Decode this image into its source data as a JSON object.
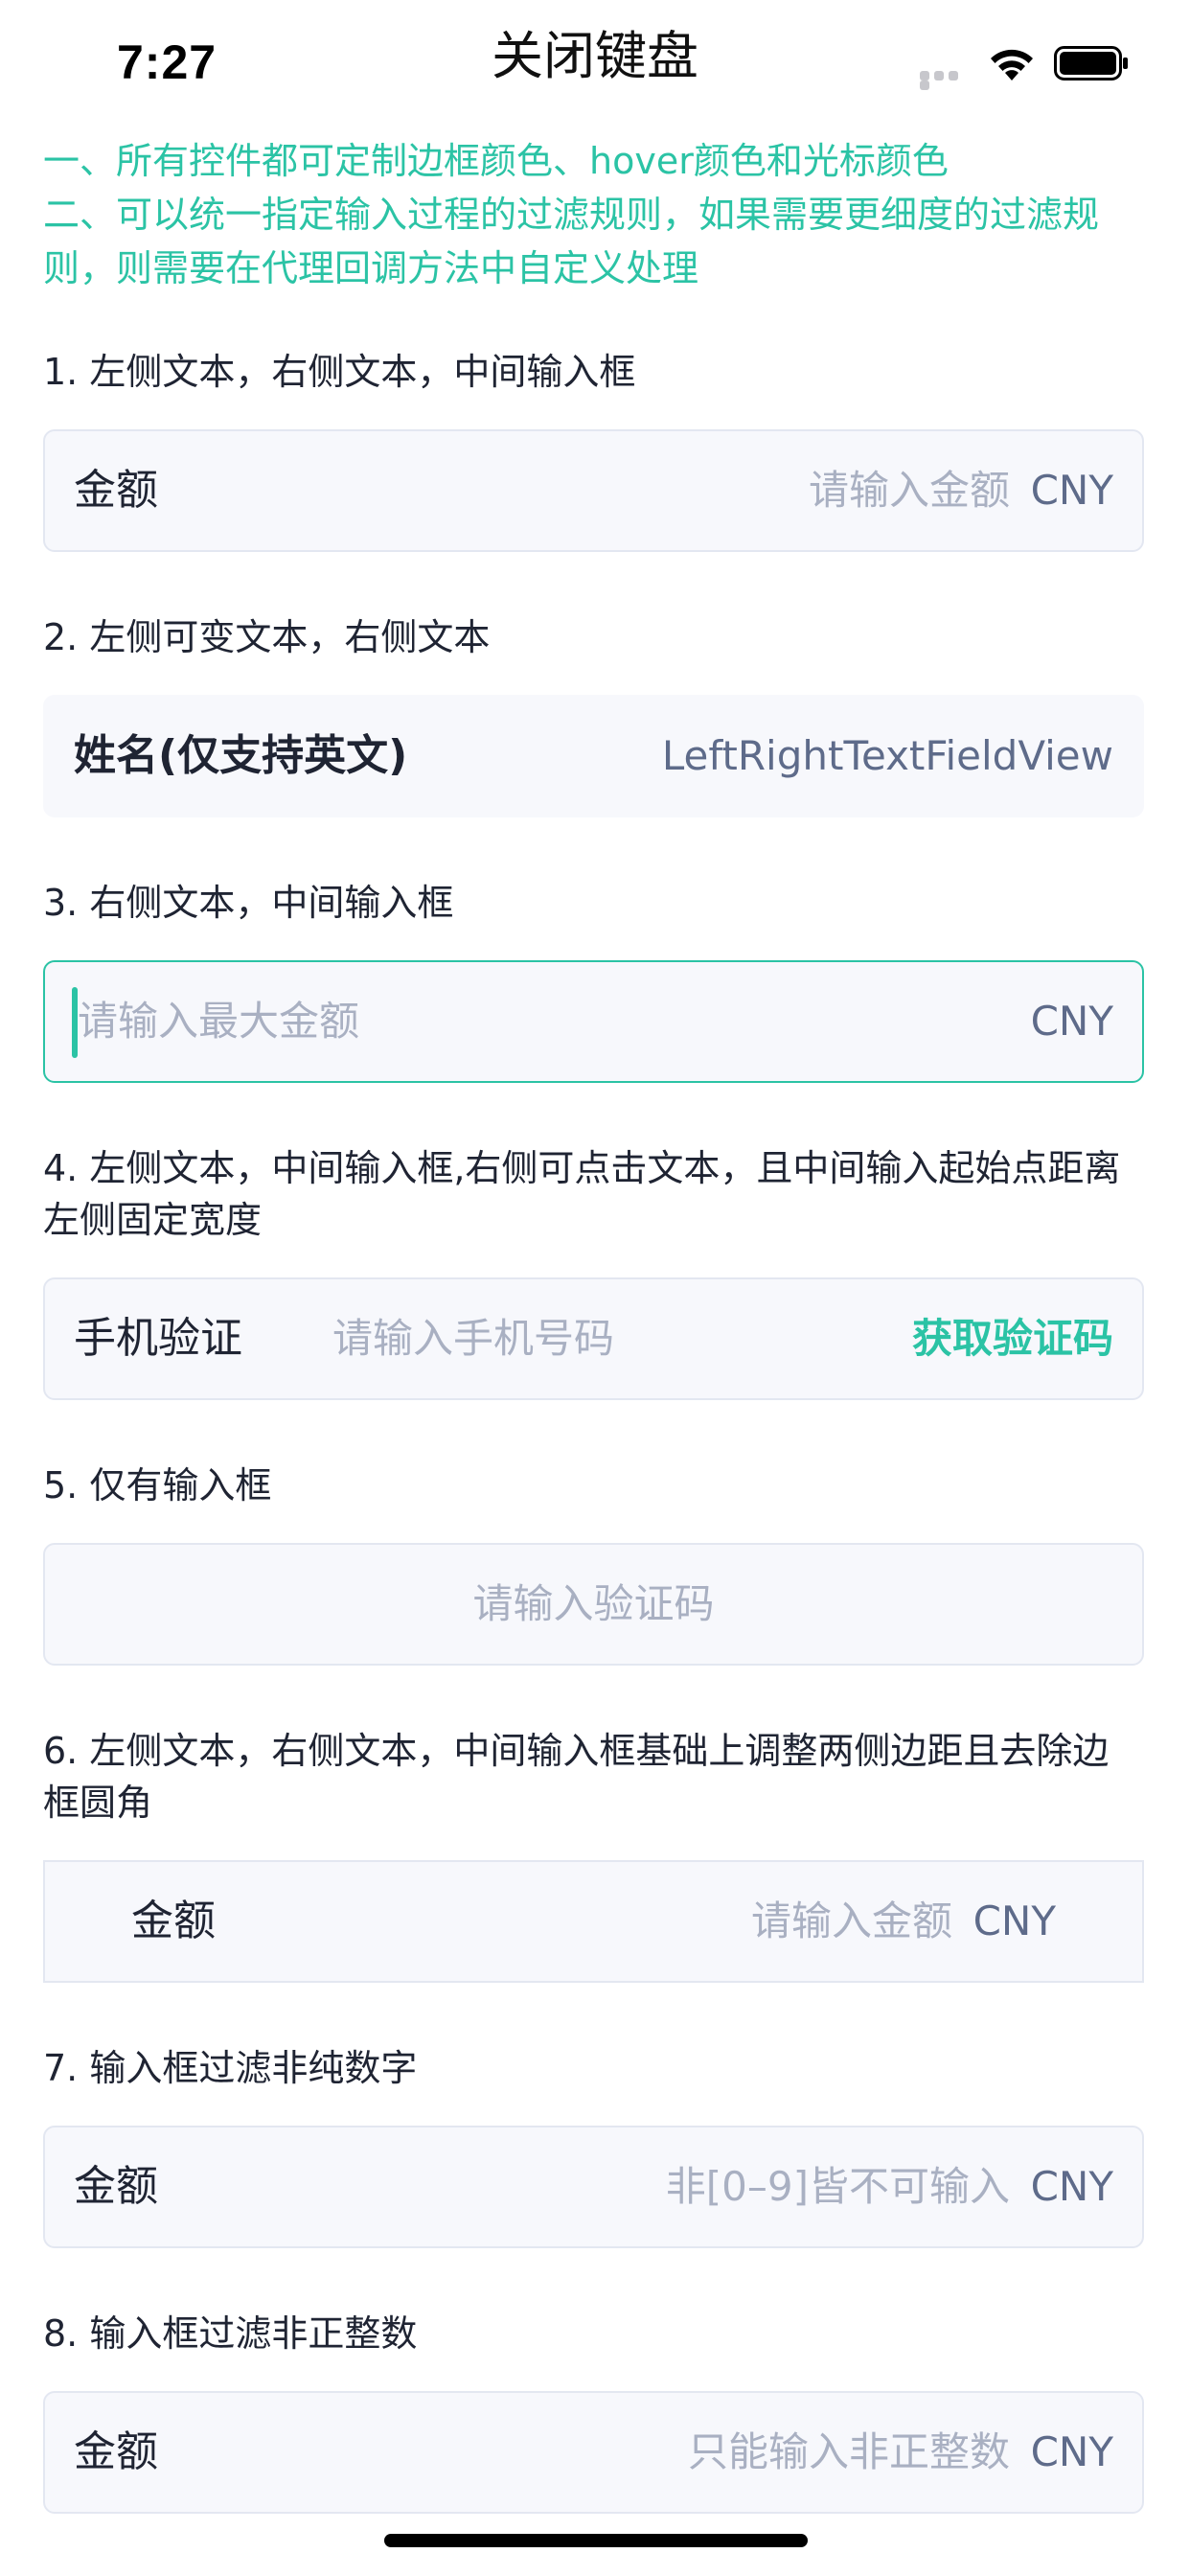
{
  "status_bar": {
    "time": "7:27"
  },
  "nav": {
    "title": "关闭键盘"
  },
  "intro": {
    "line1": "一、所有控件都可定制边框颜色、hover颜色和光标颜色",
    "line2": "二、可以统一指定输入过程的过滤规则，如果需要更细度的过滤规",
    "line3": "则，则需要在代理回调方法中自定义处理"
  },
  "sections": [
    {
      "label": "1. 左侧文本，右侧文本，中间输入框",
      "left": "金额",
      "placeholder": "请输入金额",
      "right": "CNY"
    },
    {
      "label": "2. 左侧可变文本，右侧文本",
      "left": "姓名(仅支持英文)",
      "right": "LeftRightTextFieldView"
    },
    {
      "label": "3. 右侧文本，中间输入框",
      "placeholder": "请输入最大金额",
      "right": "CNY"
    },
    {
      "label_line1": "4. 左侧文本，中间输入框,右侧可点击文本，且中间输入起始点距离",
      "label_line2": "左侧固定宽度",
      "left": "手机验证",
      "placeholder": "请输入手机号码",
      "right": "获取验证码"
    },
    {
      "label": "5. 仅有输入框",
      "placeholder": "请输入验证码"
    },
    {
      "label_line1": "6. 左侧文本，右侧文本，中间输入框基础上调整两侧边距且去除边",
      "label_line2": "框圆角",
      "left": "金额",
      "placeholder": "请输入金额",
      "right": "CNY"
    },
    {
      "label": "7. 输入框过滤非纯数字",
      "left": "金额",
      "placeholder": "非[0–9]皆不可输入",
      "right": "CNY"
    },
    {
      "label": "8. 输入框过滤非正整数",
      "left": "金额",
      "placeholder": "只能输入非正整数",
      "right": "CNY"
    }
  ],
  "colors": {
    "accent": "#2bc3a5",
    "field_bg": "#f7f8fc",
    "field_border": "#e3e7f1",
    "placeholder": "#a9b0c2",
    "unit_text": "#5e6b8a"
  }
}
